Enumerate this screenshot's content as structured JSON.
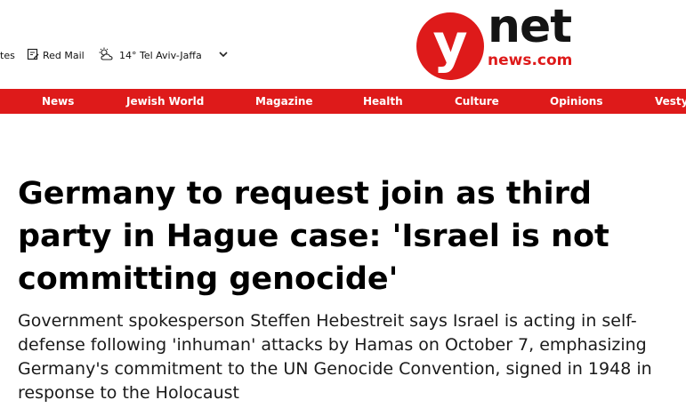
{
  "utility": {
    "updates_label": "tes",
    "redmail_label": "Red Mail",
    "weather_label": "14° Tel Aviv-Jaffa",
    "icons": [
      "edit-icon",
      "sun-cloud-icon",
      "chevron-down-icon"
    ]
  },
  "logo": {
    "y": "y",
    "net": "net",
    "news": "news.com",
    "brand_color": "#de1a1a"
  },
  "nav": {
    "items": [
      "News",
      "Jewish World",
      "Magazine",
      "Health",
      "Culture",
      "Opinions",
      "Vesty"
    ]
  },
  "article": {
    "headline": "Germany to request join as third party in Hague case: 'Israel is not committing genocide'",
    "subheadline": "Government spokesperson Steffen Hebestreit says Israel is acting in self-defense following 'inhuman' attacks by Hamas on October 7, emphasizing Germany's commitment to the UN Genocide Convention, signed in 1948 in response to the Holocaust"
  }
}
